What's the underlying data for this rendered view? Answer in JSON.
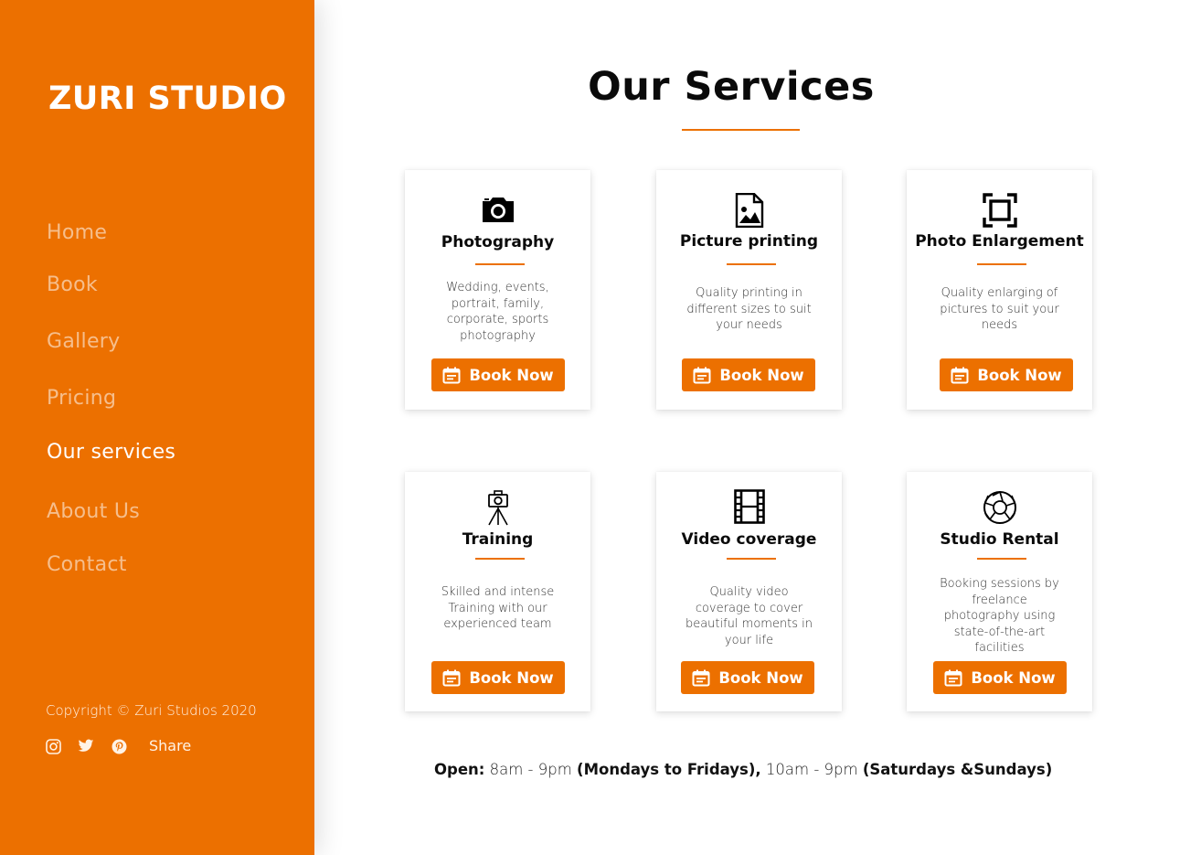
{
  "sidebar": {
    "brand": "ZURI STUDIO",
    "nav": [
      {
        "label": "Home"
      },
      {
        "label": "Book"
      },
      {
        "label": "Gallery"
      },
      {
        "label": "Pricing"
      },
      {
        "label": "Our services",
        "active": true
      },
      {
        "label": "About Us"
      },
      {
        "label": "Contact"
      }
    ],
    "copyright": "Copyright © Zuri Studios 2020",
    "social": {
      "icons": [
        "instagram-icon",
        "twitter-icon",
        "pinterest-icon"
      ],
      "share_label": "Share"
    },
    "background": "#ec7000"
  },
  "main": {
    "title": "Our Services",
    "accent": "#ec7000",
    "services": [
      {
        "icon": "camera-icon",
        "title": "Photography",
        "description": "Wedding, events, portrait, family, corporate, sports photography",
        "button": "Book Now"
      },
      {
        "icon": "image-file-icon",
        "title": "Picture printing",
        "description": "Quality printing in different sizes to suit your needs",
        "button": "Book Now"
      },
      {
        "icon": "enlarge-frame-icon",
        "title": "Photo Enlargement",
        "description": "Quality enlarging of pictures to suit your needs",
        "button": "Book Now"
      },
      {
        "icon": "tripod-camera-icon",
        "title": "Training",
        "description": "Skilled and intense Training with our experienced team",
        "button": "Book Now"
      },
      {
        "icon": "film-strip-icon",
        "title": "Video coverage",
        "description": "Quality video coverage to cover beautiful moments in your life",
        "button": "Book Now"
      },
      {
        "icon": "aperture-icon",
        "title": "Studio Rental",
        "description": "Booking sessions by freelance photography using state-of-the-art facilities",
        "button": "Book Now"
      }
    ],
    "hours": {
      "open_label": "Open:",
      "weekday_hours": "8am - 9pm",
      "weekday_days": "(Mondays to Fridays),",
      "weekend_hours": "10am - 9pm",
      "weekend_days": "(Saturdays &Sundays)"
    }
  }
}
